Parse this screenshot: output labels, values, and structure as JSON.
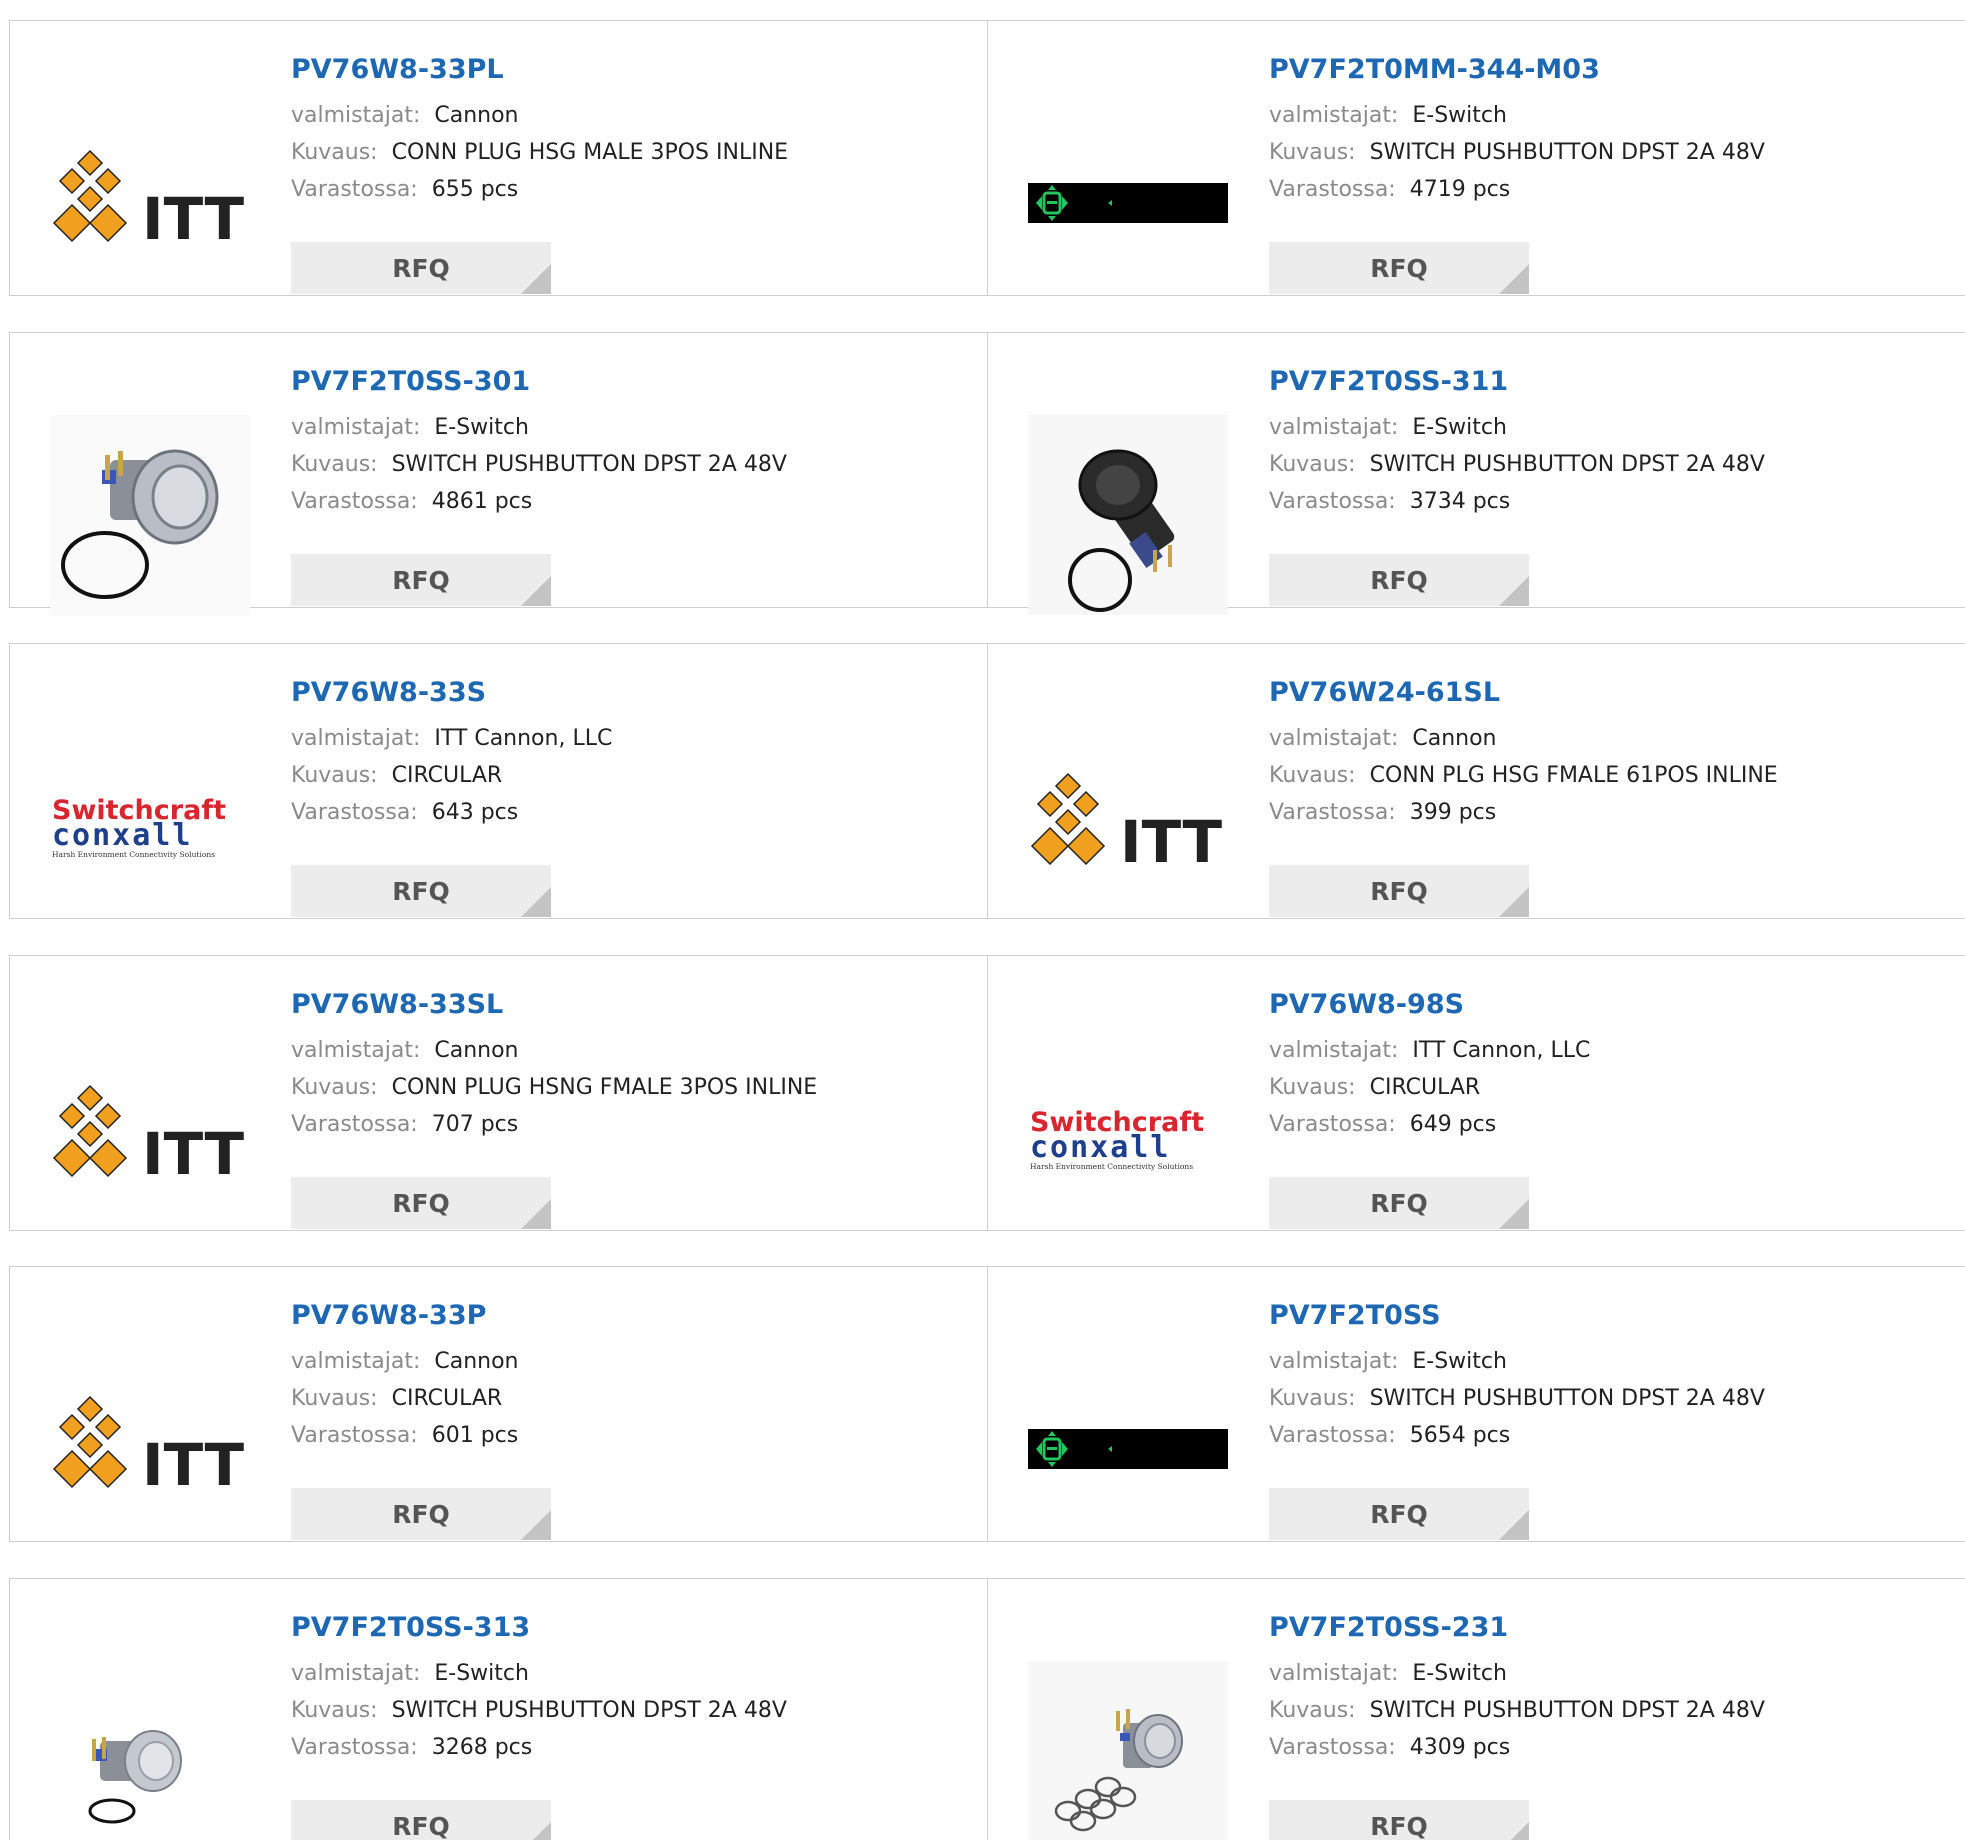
{
  "labels": {
    "manufacturer": "valmistajat:",
    "description": "Kuvaus:",
    "stock": "Varastossa:",
    "rfq": "RFQ"
  },
  "products": [
    {
      "part": "PV76W8-33PL",
      "manufacturer": "Cannon",
      "description": "CONN PLUG HSG MALE 3POS INLINE",
      "stock": "655 pcs",
      "image": "itt-logo"
    },
    {
      "part": "PV7F2T0MM-344-M03",
      "manufacturer": "E-Switch",
      "description": "SWITCH PUSHBUTTON DPST 2A 48V",
      "stock": "4719 pcs",
      "image": "eswitch-logo"
    },
    {
      "part": "PV7F2T0SS-301",
      "manufacturer": "E-Switch",
      "description": "SWITCH PUSHBUTTON DPST 2A 48V",
      "stock": "4861 pcs",
      "image": "pushbutton-silver"
    },
    {
      "part": "PV7F2T0SS-311",
      "manufacturer": "E-Switch",
      "description": "SWITCH PUSHBUTTON DPST 2A 48V",
      "stock": "3734 pcs",
      "image": "pushbutton-black"
    },
    {
      "part": "PV76W8-33S",
      "manufacturer": "ITT Cannon, LLC",
      "description": "CIRCULAR",
      "stock": "643 pcs",
      "image": "switchcraft-conxall-logo"
    },
    {
      "part": "PV76W24-61SL",
      "manufacturer": "Cannon",
      "description": "CONN PLG HSG FMALE 61POS INLINE",
      "stock": "399 pcs",
      "image": "itt-logo"
    },
    {
      "part": "PV76W8-33SL",
      "manufacturer": "Cannon",
      "description": "CONN PLUG HSNG FMALE 3POS INLINE",
      "stock": "707 pcs",
      "image": "itt-logo"
    },
    {
      "part": "PV76W8-98S",
      "manufacturer": "ITT Cannon, LLC",
      "description": "CIRCULAR",
      "stock": "649 pcs",
      "image": "switchcraft-conxall-logo"
    },
    {
      "part": "PV76W8-33P",
      "manufacturer": "Cannon",
      "description": "CIRCULAR",
      "stock": "601 pcs",
      "image": "itt-logo"
    },
    {
      "part": "PV7F2T0SS",
      "manufacturer": "E-Switch",
      "description": "SWITCH PUSHBUTTON DPST 2A 48V",
      "stock": "5654 pcs",
      "image": "eswitch-logo"
    },
    {
      "part": "PV7F2T0SS-313",
      "manufacturer": "E-Switch",
      "description": "SWITCH PUSHBUTTON DPST 2A 48V",
      "stock": "3268 pcs",
      "image": "pushbutton-silver-small"
    },
    {
      "part": "PV7F2T0SS-231",
      "manufacturer": "E-Switch",
      "description": "SWITCH PUSHBUTTON DPST 2A 48V",
      "stock": "4309 pcs",
      "image": "pushbutton-rings"
    }
  ],
  "logo_text": {
    "itt": "ITT",
    "switchcraft": "Switchcraft",
    "conxall": "conxall",
    "conxall_tagline": "Harsh Environment Connectivity Solutions"
  },
  "colors": {
    "link": "#1d67b3",
    "itt_orange": "#f0a01e",
    "switchcraft_red": "#d8262e",
    "conxall_blue": "#1d3f8c",
    "eswitch_green": "#22c55e"
  }
}
